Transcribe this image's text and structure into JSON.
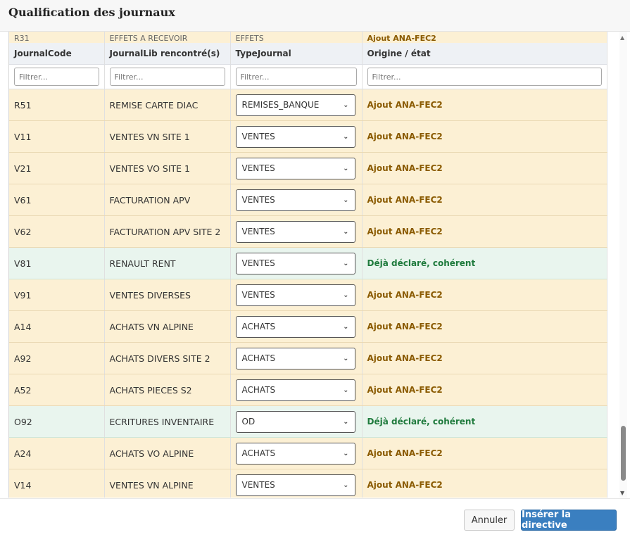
{
  "dialog": {
    "title": "Qualification des journaux",
    "cancel_label": "Annuler",
    "submit_label": "Insérer la directive"
  },
  "columns": {
    "code": "JournalCode",
    "lib": "JournalLib rencontré(s)",
    "type": "TypeJournal",
    "origin": "Origine / état"
  },
  "filters": {
    "placeholder": "Filtrer..."
  },
  "partial_row": {
    "code": "R31",
    "lib": "EFFETS A RECEVOIR",
    "type": "EFFETS",
    "origin": "Ajout ANA-FEC2"
  },
  "rows": [
    {
      "code": "R51",
      "lib": "REMISE CARTE DIAC",
      "type": "REMISES_BANQUE",
      "origin": "Ajout ANA-FEC2",
      "state": "warn"
    },
    {
      "code": "V11",
      "lib": "VENTES VN SITE 1",
      "type": "VENTES",
      "origin": "Ajout ANA-FEC2",
      "state": "warn"
    },
    {
      "code": "V21",
      "lib": "VENTES VO SITE 1",
      "type": "VENTES",
      "origin": "Ajout ANA-FEC2",
      "state": "warn"
    },
    {
      "code": "V61",
      "lib": "FACTURATION APV",
      "type": "VENTES",
      "origin": "Ajout ANA-FEC2",
      "state": "warn"
    },
    {
      "code": "V62",
      "lib": "FACTURATION APV SITE 2",
      "type": "VENTES",
      "origin": "Ajout ANA-FEC2",
      "state": "warn"
    },
    {
      "code": "V81",
      "lib": "RENAULT RENT",
      "type": "VENTES",
      "origin": "Déjà déclaré, cohérent",
      "state": "ok"
    },
    {
      "code": "V91",
      "lib": "VENTES DIVERSES",
      "type": "VENTES",
      "origin": "Ajout ANA-FEC2",
      "state": "warn"
    },
    {
      "code": "A14",
      "lib": "ACHATS VN ALPINE",
      "type": "ACHATS",
      "origin": "Ajout ANA-FEC2",
      "state": "warn"
    },
    {
      "code": "A92",
      "lib": "ACHATS DIVERS SITE 2",
      "type": "ACHATS",
      "origin": "Ajout ANA-FEC2",
      "state": "warn"
    },
    {
      "code": "A52",
      "lib": "ACHATS PIECES S2",
      "type": "ACHATS",
      "origin": "Ajout ANA-FEC2",
      "state": "warn"
    },
    {
      "code": "O92",
      "lib": "ECRITURES INVENTAIRE",
      "type": "OD",
      "origin": "Déjà déclaré, cohérent",
      "state": "ok"
    },
    {
      "code": "A24",
      "lib": "ACHATS VO ALPINE",
      "type": "ACHATS",
      "origin": "Ajout ANA-FEC2",
      "state": "warn"
    },
    {
      "code": "V14",
      "lib": "VENTES VN ALPINE",
      "type": "VENTES",
      "origin": "Ajout ANA-FEC2",
      "state": "warn"
    }
  ],
  "colors": {
    "warn_bg": "#fcf0d4",
    "ok_bg": "#e9f5ee",
    "warn_text": "#8a5a00",
    "ok_text": "#1e7a3c",
    "primary": "#3a7fc0"
  }
}
